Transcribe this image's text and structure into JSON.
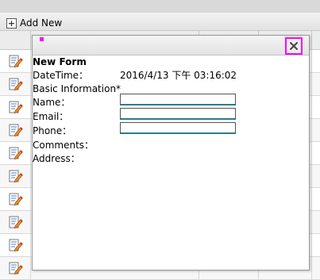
{
  "toolbar": {
    "add_new_label": "Add New",
    "add_icon": "plus-icon"
  },
  "grid": {
    "row_icon": "edit-icon",
    "row_count": 10
  },
  "dialog": {
    "close_icon": "close-icon",
    "close_glyph": "✕",
    "title": "New Form",
    "datetime_label": "DateTime：",
    "datetime_value": "2016/4/13 下午 03:16:02",
    "section_label": "Basic Information*",
    "name_label": "Name：",
    "email_label": "Email：",
    "phone_label": "Phone：",
    "comments_label": "Comments：",
    "address_label": "Address：",
    "name_value": "",
    "email_value": "",
    "phone_value": ""
  },
  "colors": {
    "highlight": "#ff00ff",
    "field_focus": "#2a7a8c"
  }
}
